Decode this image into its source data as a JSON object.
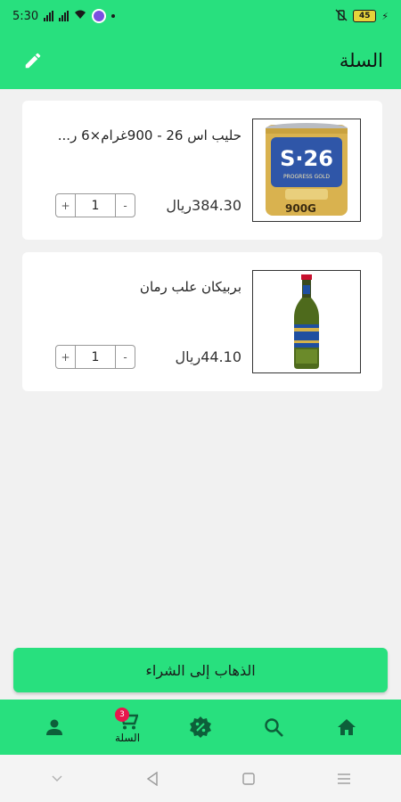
{
  "status_bar": {
    "time": "5:30",
    "battery": "45"
  },
  "app_bar": {
    "title": "السلة"
  },
  "cart_items": [
    {
      "name": "حليب اس 26 - 900غرام×6 ر...",
      "price": "384.30ريال",
      "quantity": "1",
      "image": "s26-milk-can"
    },
    {
      "name": "بربيكان علب رمان",
      "price": "44.10ريال",
      "quantity": "1",
      "image": "barbican-bottle"
    }
  ],
  "stepper": {
    "plus": "+",
    "minus": "-"
  },
  "checkout": {
    "label": "الذهاب إلى الشراء"
  },
  "bottom_nav": {
    "items": [
      {
        "icon": "person-icon"
      },
      {
        "icon": "cart-icon",
        "label": "السلة",
        "badge": "3"
      },
      {
        "icon": "discount-badge-icon"
      },
      {
        "icon": "search-icon"
      },
      {
        "icon": "home-icon"
      }
    ]
  },
  "colors": {
    "accent": "#28e07e",
    "badge": "#e8174d",
    "background": "#f1f1f1"
  }
}
